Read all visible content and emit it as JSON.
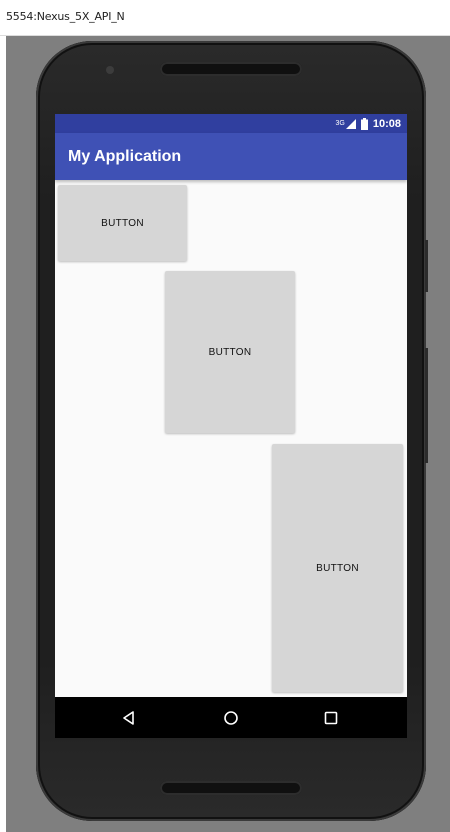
{
  "window": {
    "title": "5554:Nexus_5X_API_N"
  },
  "status_bar": {
    "network": "3G",
    "time": "10:08"
  },
  "app_bar": {
    "title": "My Application"
  },
  "buttons": [
    {
      "label": "BUTTON"
    },
    {
      "label": "BUTTON"
    },
    {
      "label": "BUTTON"
    }
  ],
  "nav_bar": {
    "icons": [
      "back-icon",
      "home-icon",
      "recents-icon"
    ]
  },
  "colors": {
    "status_bar": "#303f9f",
    "app_bar": "#3f51b5",
    "content_bg": "#fafafa",
    "button_bg": "#d6d6d6",
    "nav_bar": "#000000",
    "emulator_bg": "#7f7f7f"
  }
}
